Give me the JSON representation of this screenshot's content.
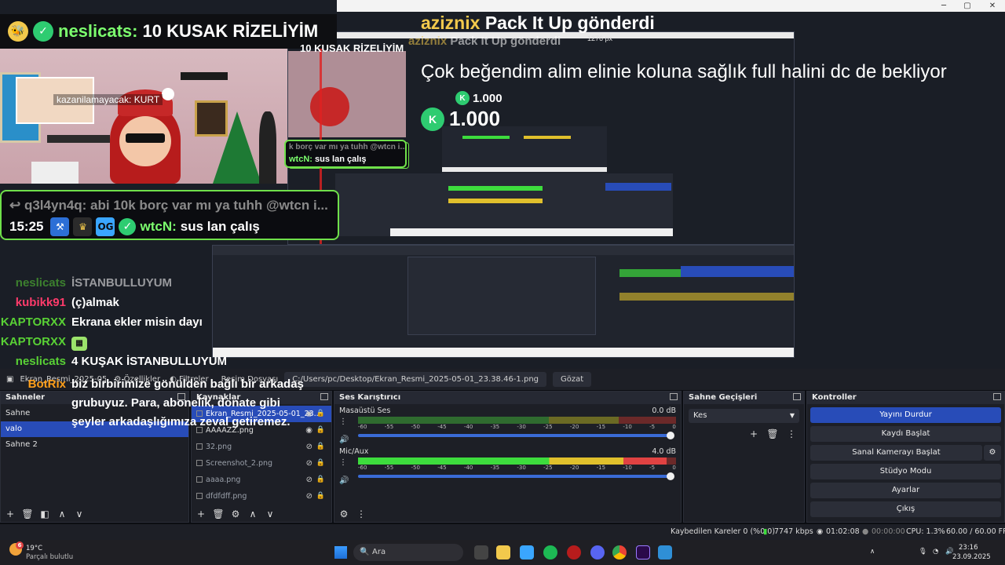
{
  "window": {
    "minimize": "─",
    "maximize": "▢",
    "close": "✕"
  },
  "alerts": {
    "pack": {
      "user": "aziznix",
      "text": "Pack It Up gönderdi"
    },
    "ghost_pack": {
      "user": "aziznix",
      "text": "Pack It Up gönderdi"
    },
    "comment": "Çok beğendim alim elinie koluna sağlık full halini dc de bekliyor",
    "amount": "1.000",
    "amount_small": "1.000",
    "px_label": "1276 px"
  },
  "top_chat": {
    "user": "neslicats:",
    "message": "10 KUSAK RİZELİYİM",
    "ghost": "10 KUSAK RİZELİYİM"
  },
  "cam": {
    "caption": "kazanilamayacak: KURT"
  },
  "chat_box": {
    "reply": "q3l4yn4q: abi 10k borç var mı ya tuhh @wtcn i...",
    "time": "15:25",
    "user": "wtcN:",
    "message": "sus lan çalış",
    "ghost_reply": "k borç var mı ya tuhh @wtcn i...",
    "ghost_user": "wtcN:",
    "ghost_message": "sus lan çalış"
  },
  "chat": [
    {
      "user": "neslicats",
      "color": "#59d135",
      "text": "İSTANBULLUYUM",
      "dim": true
    },
    {
      "user": "kubikk91",
      "color": "#ff3b6b",
      "text": "(ç)almak"
    },
    {
      "user": "KAPTORXX",
      "color": "#59d135",
      "text": "Ekrana ekler misin dayı"
    },
    {
      "user": "KAPTORXX",
      "color": "#59d135",
      "text": ""
    },
    {
      "user": "neslicats",
      "color": "#59d135",
      "text": "4 KUŞAK İSTANBULLUYUM"
    }
  ],
  "chat_last": {
    "user": "BotRix",
    "color": "#ff9f1a",
    "text": "biz birbirimize gönülden bağlı bir arkadaş grubuyuz. Para, abonelik, donate gibi şeyler arkadaşlığımıza zeval getiremez."
  },
  "source_bar": {
    "name": "Ekran_Resmi_2025-05-01_2...",
    "properties": "Özellikler",
    "filters": "Filtreler",
    "file_label": "Resim Dosyası",
    "path": "C:/Users/pc/Desktop/Ekran_Resmi_2025-05-01_23.38.46-1.png",
    "browse": "Gözat"
  },
  "scenes": {
    "title": "Sahneler",
    "items": [
      "Sahne",
      "valo",
      "Sahne 2"
    ],
    "selected": 1
  },
  "sources": {
    "title": "Kaynaklar",
    "items": [
      {
        "name": "Ekran_Resmi_2025-05-01_23...",
        "visible": true
      },
      {
        "name": "AAAAZZ.png",
        "visible": true
      },
      {
        "name": "32.png",
        "visible": false
      },
      {
        "name": "Screenshot_2.png",
        "visible": false
      },
      {
        "name": "aaaa.png",
        "visible": false
      },
      {
        "name": "dfdfdff.png",
        "visible": false
      }
    ],
    "selected": 0
  },
  "mixer": {
    "title": "Ses Karıştırıcı",
    "channels": [
      {
        "name": "Masaüstü Ses",
        "db": "0.0 dB",
        "level": 0.0
      },
      {
        "name": "Mic/Aux",
        "db": "4.0 dB",
        "level": 0.97
      }
    ],
    "ticks": [
      "-60",
      "-55",
      "-50",
      "-45",
      "-40",
      "-35",
      "-30",
      "-25",
      "-20",
      "-15",
      "-10",
      "-5",
      "0"
    ]
  },
  "transitions": {
    "title": "Sahne Geçişleri",
    "value": "Kes"
  },
  "controls": {
    "title": "Kontroller",
    "buttons": [
      "Yayını Durdur",
      "Kaydı Başlat",
      "Sanal Kamerayı Başlat",
      "Stüdyo Modu",
      "Ayarlar",
      "Çıkış"
    ]
  },
  "status": {
    "dropped": "Kaybedilen Kareler 0 (%0.0)",
    "bitrate": "7747 kbps",
    "stream_time": "01:02:08",
    "rec_time": "00:00:00",
    "cpu": "CPU: 1.3%",
    "fps": "60.00 / 60.00 FPS"
  },
  "taskbar": {
    "temp": "19°C",
    "weather": "Parçalı bulutlu",
    "search": "Ara",
    "time": "23:16",
    "date": "23.09.2025",
    "notif": "6"
  },
  "colors": {
    "accent": "#284cb8",
    "chat_border": "#6fe04a",
    "alert_user": "#f2c94c"
  }
}
